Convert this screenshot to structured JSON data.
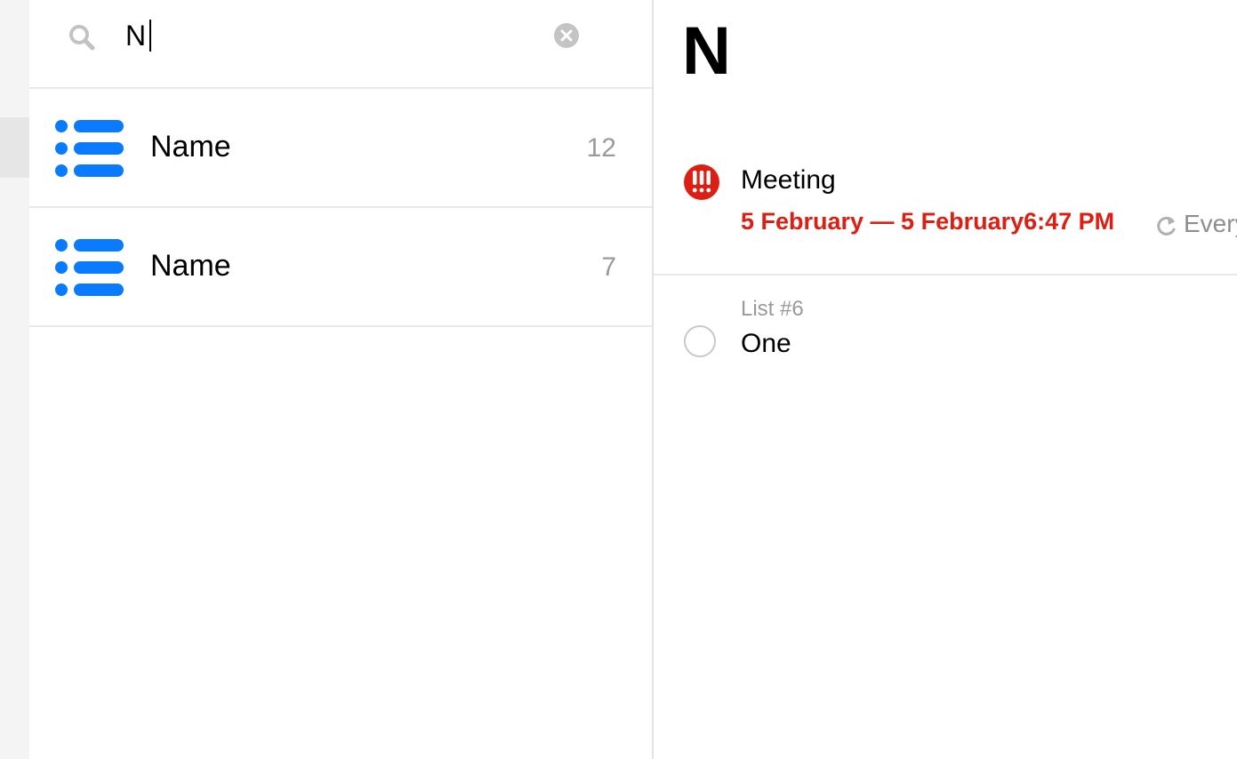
{
  "search": {
    "value": "N",
    "clear_icon": "clear-circle-icon",
    "search_icon": "magnifier-icon"
  },
  "results": [
    {
      "icon": "list-bullets-icon",
      "name": "Name",
      "count": "12"
    },
    {
      "icon": "list-bullets-icon",
      "name": "Name",
      "count": "7"
    }
  ],
  "detail": {
    "title": "N",
    "reminders": [
      {
        "priority_icon": "high-priority-icon",
        "title": "Meeting",
        "date": "5 February — 5 February6:47 PM",
        "repeat_icon": "repeat-icon",
        "repeat": "Every"
      },
      {
        "list": "List #6",
        "title": "One"
      }
    ]
  },
  "colors": {
    "accent_blue": "#0a7aff",
    "overdue_red": "#dc1f12",
    "secondary_gray": "#9a9a9a"
  }
}
